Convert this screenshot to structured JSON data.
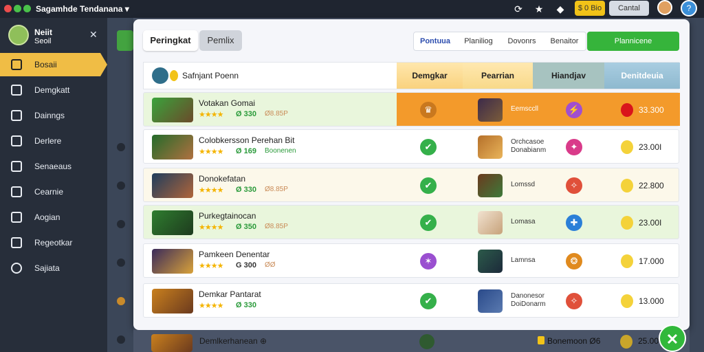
{
  "window": {
    "title": "Sagamhde Tendanana ▾"
  },
  "topbar": {
    "coin_label": "$ 0 Bio",
    "cancel_label": "Cantal"
  },
  "sidebar": {
    "user_name": "Neiit",
    "user_sub": "Seoil",
    "items": [
      {
        "label": "Bosaii",
        "active": true
      },
      {
        "label": "Demgkatt"
      },
      {
        "label": "Dainngs"
      },
      {
        "label": "Derlere"
      },
      {
        "label": "Senaeaus"
      },
      {
        "label": "Cearnie"
      },
      {
        "label": "Aogian"
      },
      {
        "label": "Regeotkar"
      },
      {
        "label": "Sajiata"
      }
    ]
  },
  "tabs": [
    "Peringkat",
    "Pemlix"
  ],
  "filters": [
    "Pontuua",
    "Planiliog",
    "Dovonrs",
    "Benaitor"
  ],
  "green_button": "Plannicene",
  "header": {
    "search": "Safnjant Poenn",
    "col_a": "Demgkar",
    "col_b": "Pearrian",
    "col_c": "Hiandjav",
    "col_d": "Denitdeuia"
  },
  "rows": [
    {
      "title": "Votakan Gomai",
      "price": "Ø 330",
      "sub": "Ø8.85P",
      "status": "gold",
      "av_name": "Eemsccll",
      "badge": "purple",
      "score": "33.300"
    },
    {
      "title": "Colobkersson Perehan Bit",
      "price": "Ø 169",
      "sub": "Boonenen",
      "status": "green",
      "av_name": "Orchcasoe\nDonabianm",
      "badge": "pink",
      "score": "23.00I"
    },
    {
      "title": "Donokefatan",
      "price": "Ø 330",
      "sub": "Ø8.85P",
      "status": "green",
      "av_name": "Lomssd",
      "badge": "red",
      "score": "22.800"
    },
    {
      "title": "Purkegtainocan",
      "price": "Ø 350",
      "sub": "Ø8.85P",
      "status": "green",
      "av_name": "Lomasa",
      "badge": "blue",
      "score": "23.00I"
    },
    {
      "title": "Pamkeen Denentar",
      "price": "G 300",
      "sub": "ØØ",
      "status": "purple",
      "av_name": "Lamnsa",
      "badge": "orange",
      "score": "17.000"
    },
    {
      "title": "Demkar Pantarat",
      "price": "Ø 330",
      "sub": "",
      "status": "green",
      "av_name": "Danonesor\nDoiDonarm",
      "badge": "red",
      "score": "13.000"
    }
  ],
  "peek_row": {
    "title": "Demlkerhanean ⊕",
    "label": "Bonemoon Ø6",
    "score": "25.000"
  },
  "colors": {
    "accent": "#f39a2b",
    "green": "#36b43b",
    "sidebar_bg": "#272e3a",
    "active_item": "#f0bd45"
  }
}
